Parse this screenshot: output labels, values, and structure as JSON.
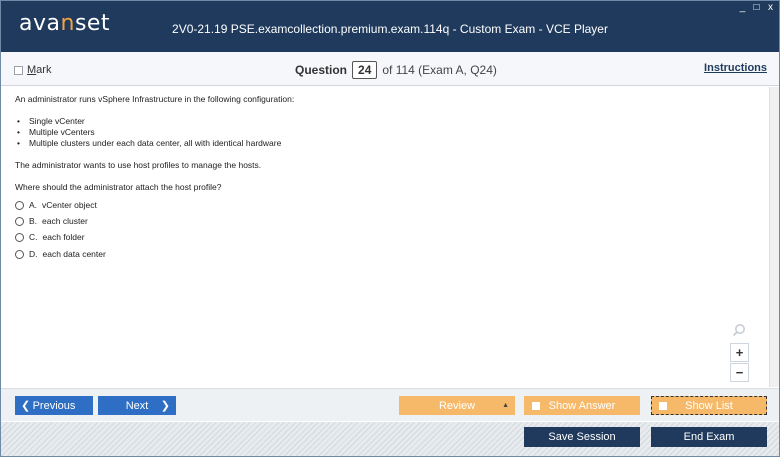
{
  "app": {
    "logo_left": "ava",
    "logo_accent": "n",
    "logo_right": "set",
    "title": "2V0-21.19 PSE.examcollection.premium.exam.114q - Custom Exam - VCE Player"
  },
  "window_controls": {
    "minimize": "_",
    "maximize": "□",
    "close": "x"
  },
  "header": {
    "mark_label_u": "M",
    "mark_label_rest": "ark",
    "question_label": "Question",
    "question_number": "24",
    "question_of": "of 114 (Exam A, Q24)",
    "instructions_label": "Instructions"
  },
  "question": {
    "intro": "An administrator runs vSphere Infrastructure in the following configuration:",
    "bullets": [
      "Single vCenter",
      "Multiple vCenters",
      "Multiple clusters under each data center, all with identical hardware"
    ],
    "para2": "The administrator wants to use host profiles to manage the hosts.",
    "prompt": "Where should the administrator attach the host profile?",
    "options": [
      {
        "letter": "A.",
        "text": "vCenter object"
      },
      {
        "letter": "B.",
        "text": "each cluster"
      },
      {
        "letter": "C.",
        "text": "each folder"
      },
      {
        "letter": "D.",
        "text": "each data center"
      }
    ]
  },
  "zoom": {
    "in": "+",
    "out": "−"
  },
  "nav": {
    "previous": "Previous",
    "next": "Next",
    "review": "Review",
    "show_answer": "Show Answer",
    "show_list": "Show List",
    "save_session": "Save Session",
    "end_exam": "End Exam"
  },
  "colors": {
    "title_bar": "#1f3a5c",
    "nav_blue": "#2e6ec4",
    "orange": "#f6b96a",
    "logo_accent": "#f4a340"
  }
}
